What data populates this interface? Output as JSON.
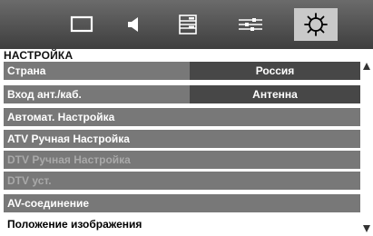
{
  "menu_tabs": [
    {
      "icon": "picture-icon",
      "selected": false
    },
    {
      "icon": "sound-icon",
      "selected": false
    },
    {
      "icon": "features-icon",
      "selected": false
    },
    {
      "icon": "preferences-icon",
      "selected": false
    },
    {
      "icon": "setup-gear-icon",
      "selected": true
    }
  ],
  "section_title": "НАСТРОЙКА",
  "items": [
    {
      "label": "Страна",
      "value": "Россия",
      "enabled": true,
      "selected": false
    },
    {
      "label": "Вход ант./каб.",
      "value": "Антенна",
      "enabled": true,
      "selected": false
    },
    {
      "label": "Автомат. Настройка",
      "enabled": true,
      "selected": false
    },
    {
      "label": "ATV Ручная Настройка",
      "enabled": true,
      "selected": false
    },
    {
      "label": "DTV Ручная Настройка",
      "enabled": false,
      "selected": false
    },
    {
      "label": "DTV уст.",
      "enabled": false,
      "selected": false
    },
    {
      "label": "AV-соединение",
      "enabled": true,
      "selected": false
    },
    {
      "label": "Положение изображения",
      "enabled": true,
      "selected": true
    }
  ],
  "colors": {
    "row_bg": "#787878",
    "value_bg": "#474747",
    "disabled_text": "#a9a9a9",
    "selected_bg": "#ffffff",
    "tab_selected_bg": "#c9c9c9"
  }
}
